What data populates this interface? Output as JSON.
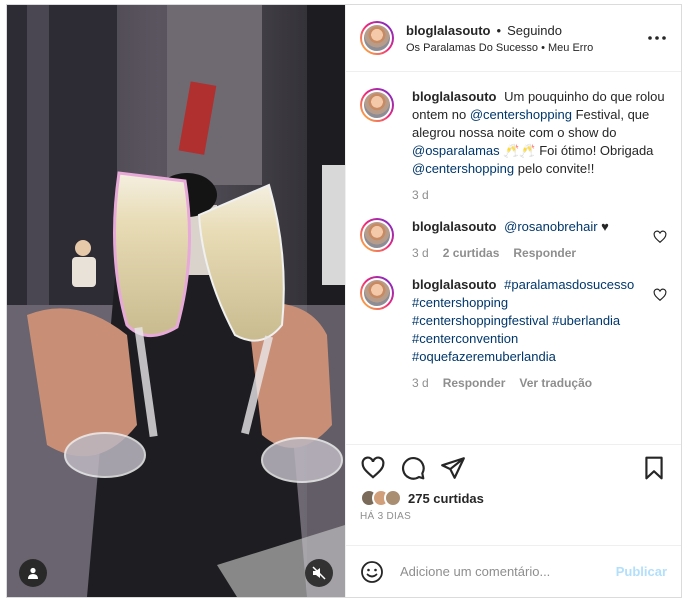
{
  "header": {
    "username": "bloglalasouto",
    "separator": "•",
    "follow_status": "Seguindo",
    "audio": "Os Paralamas Do Sucesso • Meu Erro",
    "more_icon": "more-horizontal-icon"
  },
  "caption": {
    "username": "bloglalasouto",
    "text_1": "Um pouquinho do que rolou ontem no",
    "mention_1": "@centershopping",
    "text_2": "Festival, que alegrou nossa noite com o show do",
    "mention_2": "@osparalamas",
    "text_3": "🥂🥂 Foi ótimo! Obrigada",
    "mention_3": "@centershopping",
    "text_4": "pelo convite!!",
    "time": "3 d"
  },
  "comments": [
    {
      "username": "bloglalasouto",
      "mention": "@rosanobrehair",
      "text": "♥",
      "time": "3 d",
      "likes": "2 curtidas",
      "reply": "Responder"
    },
    {
      "username": "bloglalasouto",
      "hashtags": [
        "#paralamasdosucesso",
        "#centershopping",
        "#centershoppingfestival",
        "#uberlandia",
        "#centerconvention",
        "#oquefazeremuberlandia"
      ],
      "time": "3 d",
      "reply": "Responder",
      "translate": "Ver tradução"
    }
  ],
  "actions": {
    "like_icon": "heart-icon",
    "comment_icon": "comment-icon",
    "share_icon": "send-icon",
    "save_icon": "bookmark-icon",
    "likes_count": "275 curtidas",
    "date": "HÁ 3 DIAS"
  },
  "add_comment": {
    "placeholder": "Adicione um comentário...",
    "publish": "Publicar"
  },
  "colors": {
    "link": "#00376b",
    "muted": "#8e8e8e",
    "publish_disabled": "#b2dffc"
  }
}
